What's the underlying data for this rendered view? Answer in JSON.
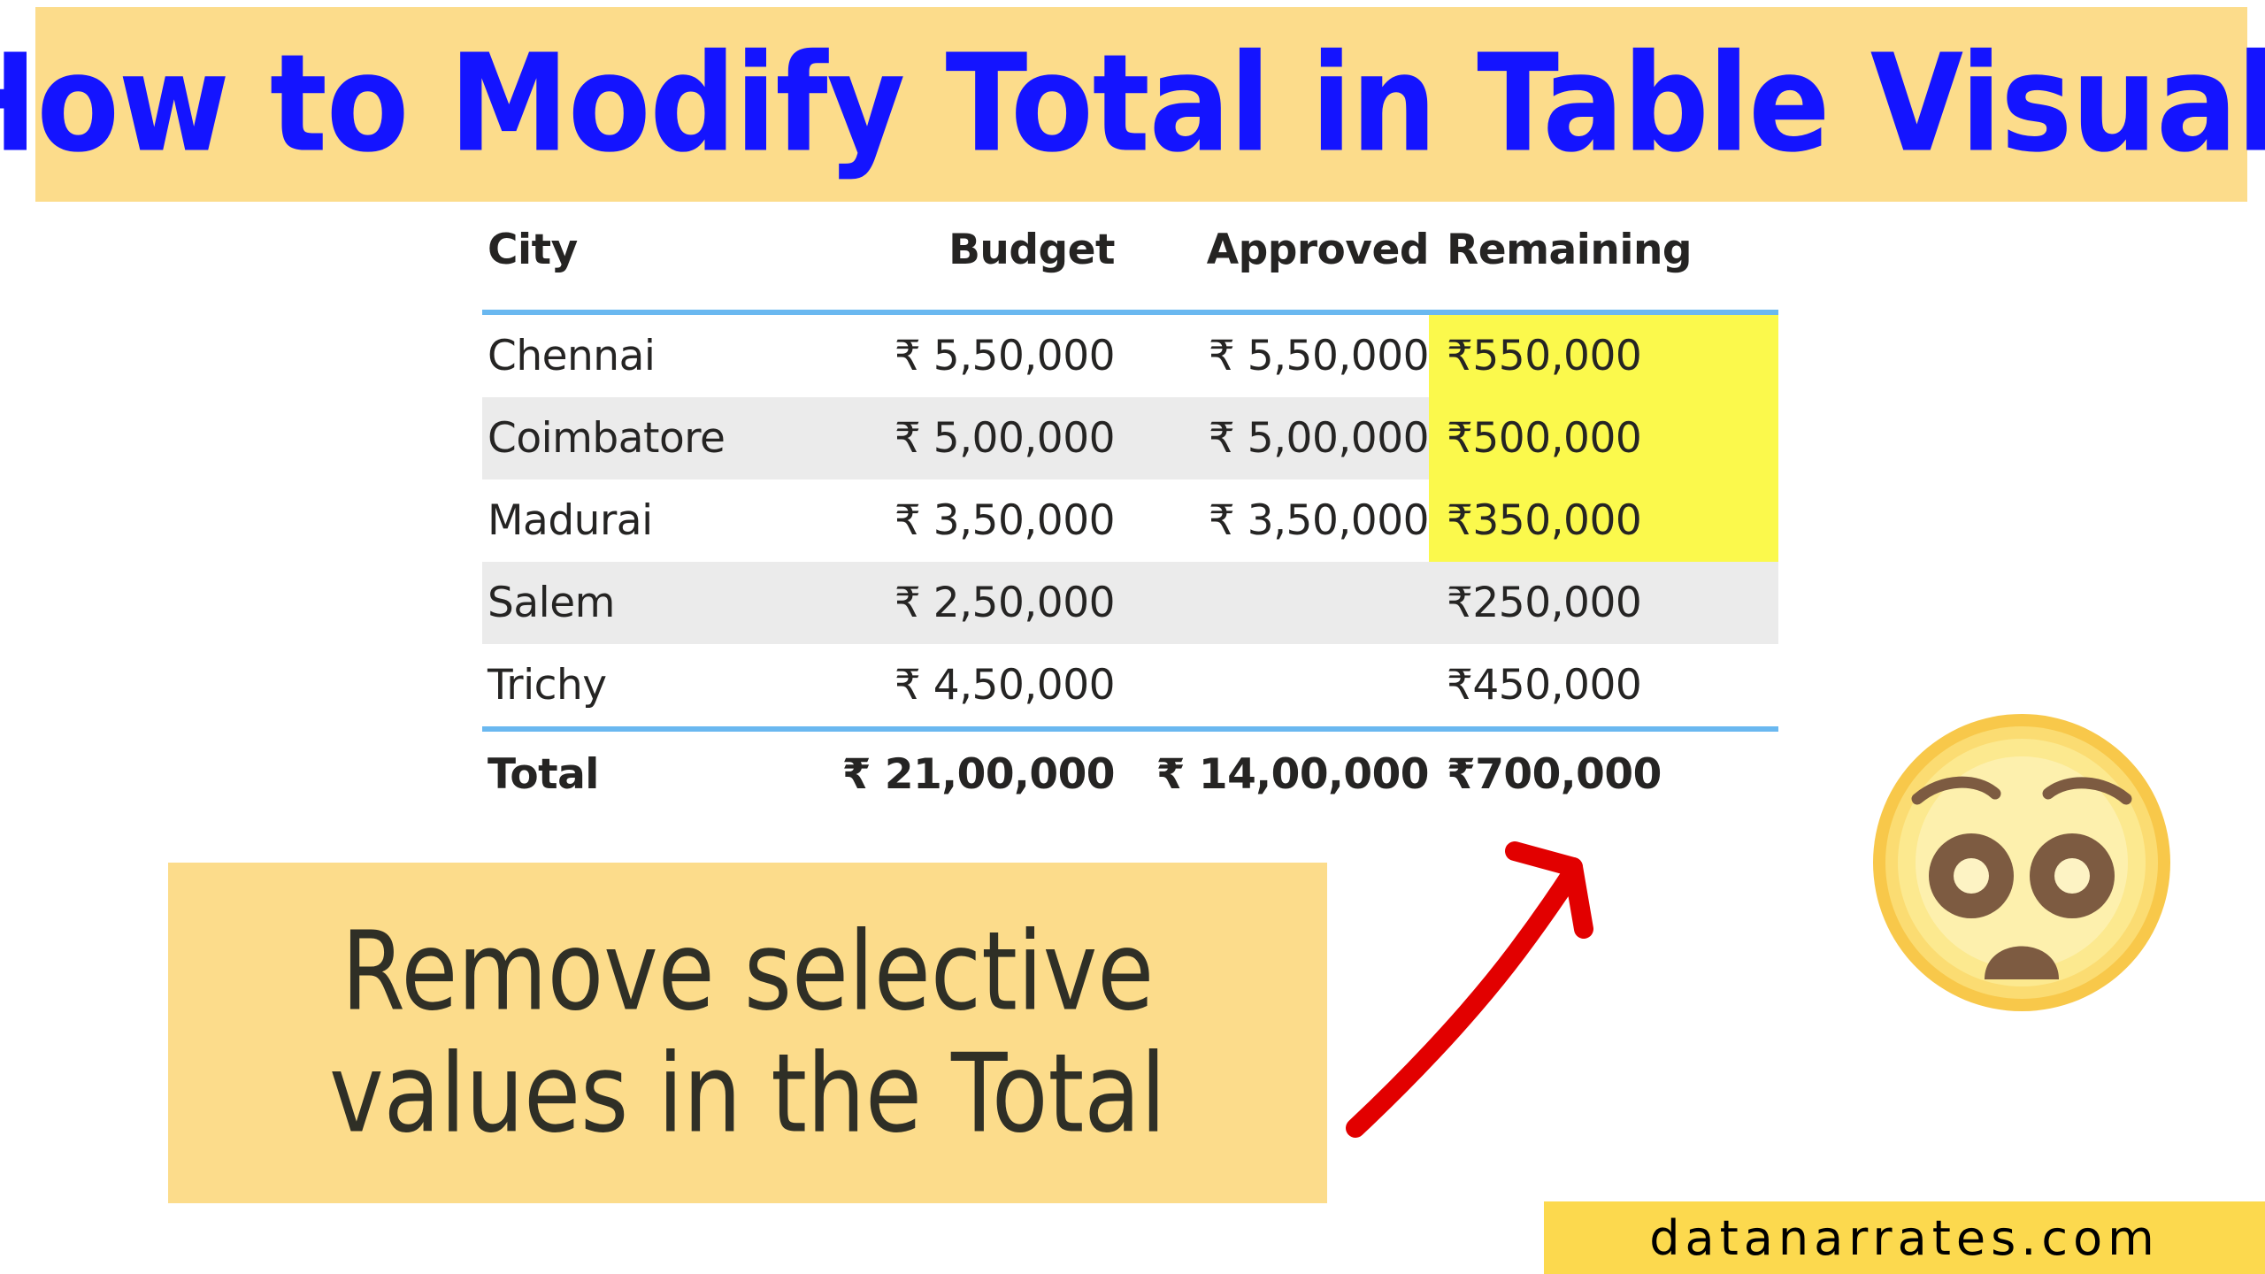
{
  "title": {
    "text": "How to Modify Total in Table Visual?",
    "text_color": "#1414ff",
    "banner_color": "#fcdc8b"
  },
  "table": {
    "columns": [
      "City",
      "Budget",
      "Approved",
      "Remaining"
    ],
    "rows": [
      {
        "city": "Chennai",
        "budget": "₹ 5,50,000",
        "approved": "₹ 5,50,000",
        "remaining": "₹550,000",
        "banded": false,
        "highlight": true
      },
      {
        "city": "Coimbatore",
        "budget": "₹ 5,00,000",
        "approved": "₹ 5,00,000",
        "remaining": "₹500,000",
        "banded": true,
        "highlight": true
      },
      {
        "city": "Madurai",
        "budget": "₹ 3,50,000",
        "approved": "₹ 3,50,000",
        "remaining": "₹350,000",
        "banded": false,
        "highlight": true
      },
      {
        "city": "Salem",
        "budget": "₹ 2,50,000",
        "approved": "",
        "remaining": "₹250,000",
        "banded": true,
        "highlight": false
      },
      {
        "city": "Trichy",
        "budget": "₹ 4,50,000",
        "approved": "",
        "remaining": "₹450,000",
        "banded": false,
        "highlight": false
      }
    ],
    "total_row": {
      "label": "Total",
      "budget": "₹ 21,00,000",
      "approved": "₹ 14,00,000",
      "remaining": "₹700,000"
    },
    "highlight_color": "#fbf94c",
    "band_color": "#ebebeb",
    "rule_color": "#6ab8f0"
  },
  "callout": {
    "line1": "Remove selective",
    "line2": "values in the Total",
    "box_color": "#fcdc8b",
    "text_color": "#2f2f26"
  },
  "arrow": {
    "color": "#e20000"
  },
  "emoji": {
    "name": "astonished-face",
    "face_color": "#fcea90",
    "rim_color": "#f8c84a",
    "feature_color": "#7d5b41"
  },
  "footer": {
    "text": "datanarrates.com",
    "band_color": "#fcd94e",
    "text_color": "#000000"
  }
}
